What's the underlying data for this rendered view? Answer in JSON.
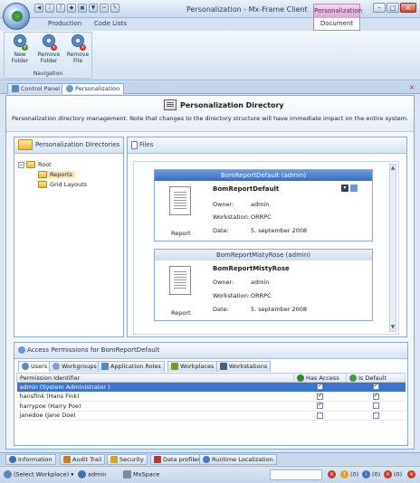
{
  "window": {
    "title": "Personalization - Mx-Frame Client",
    "contextual_tab": "Personalization",
    "qat_icons": [
      "back-icon",
      "info-icon",
      "help-icon",
      "shield-icon",
      "lock-icon",
      "filter-icon",
      "scissors-icon",
      "edit-icon"
    ]
  },
  "ribbon": {
    "tabs": [
      "Production",
      "Code Lists",
      "Document"
    ],
    "buttons": [
      {
        "label": "New Folder",
        "icon": "new-folder-gear-icon"
      },
      {
        "label": "Remove Folder",
        "icon": "remove-folder-gear-icon"
      },
      {
        "label": "Remove File",
        "icon": "remove-file-gear-icon"
      }
    ],
    "group_label": "Navigation"
  },
  "doc_tabs": [
    "Control Panel",
    "Personalization"
  ],
  "header": {
    "title": "Personalization Directory",
    "description": "Personalization directory management. Note that changes to the directory structure will have immediate impact on the entire system."
  },
  "directories": {
    "title": "Personalization Directories",
    "root": "Root",
    "children": [
      "Reports",
      "Grid Layouts"
    ],
    "selected": "Reports"
  },
  "files": {
    "title": "Files",
    "items": [
      {
        "header": "BomReportDefault (admin)",
        "name": "BomReportDefault",
        "owner_label": "Owner:",
        "owner": "admin",
        "workstation_label": "Workstation:",
        "workstation": "ORRPC",
        "date_label": "Date:",
        "date": "5. september 2008",
        "type": "Report"
      },
      {
        "header": "BomReportMistyRose (admin)",
        "name": "BomReportMistyRose",
        "owner_label": "Owner:",
        "owner": "admin",
        "workstation_label": "Workstation:",
        "workstation": "ORRPC",
        "date_label": "Date:",
        "date": "5. september 2008",
        "type": "Report"
      }
    ]
  },
  "permissions": {
    "title": "Access Permissions for BomReportDefault",
    "tabs": [
      "Users",
      "Workgroups",
      "Application Roles",
      "Workplaces",
      "Workstations"
    ],
    "columns": [
      "Permission Identifier",
      "Has Access",
      "Is Default"
    ],
    "rows": [
      {
        "id": "admin (System Administrator )",
        "has_access": true,
        "is_default": true
      },
      {
        "id": "hansfink (Hans Fink)",
        "has_access": true,
        "is_default": true
      },
      {
        "id": "harrypoe (Harry Poe)",
        "has_access": true,
        "is_default": false
      },
      {
        "id": "janedoe (Jane Doe)",
        "has_access": false,
        "is_default": false
      }
    ]
  },
  "tool_tabs": [
    "Information",
    "Audit Trail",
    "Security",
    "Data profiler",
    "Runtime Localization"
  ],
  "status": {
    "workplace": "(Select Workplace)",
    "user": "admin",
    "space": "MxSpace",
    "errors": "(0)",
    "warnings": "(0)",
    "infos": "(0)",
    "alerts": "(0)"
  },
  "colors": {
    "selection": "#3f74c8",
    "accent": "#3a6cc2",
    "contextual": "#d9a7d4"
  }
}
